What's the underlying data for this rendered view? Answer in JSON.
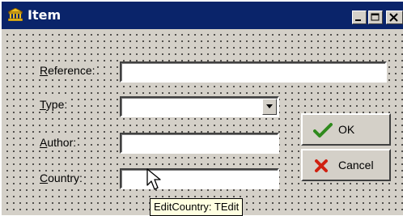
{
  "window": {
    "title": "Item"
  },
  "title_buttons": {
    "minimize": "minimize-icon",
    "maximize": "maximize-icon",
    "close": "close-icon"
  },
  "form": {
    "reference": {
      "label_first": "R",
      "label_rest": "eference:",
      "value": ""
    },
    "type": {
      "label_first": "T",
      "label_rest": "ype:",
      "value": ""
    },
    "author": {
      "label_first": "A",
      "label_rest": "uthor:",
      "value": ""
    },
    "country": {
      "label_first": "C",
      "label_rest": "ountry:",
      "value": ""
    }
  },
  "buttons": {
    "ok_label": "OK",
    "cancel_label": "Cancel"
  },
  "tooltip": {
    "text": "EditCountry: TEdit"
  },
  "colors": {
    "title_bar": "#0a246a",
    "face": "#d4d0c8",
    "tooltip_bg": "#ffffe1",
    "ok_check": "#2f8a1d",
    "cancel_x": "#d02010"
  }
}
